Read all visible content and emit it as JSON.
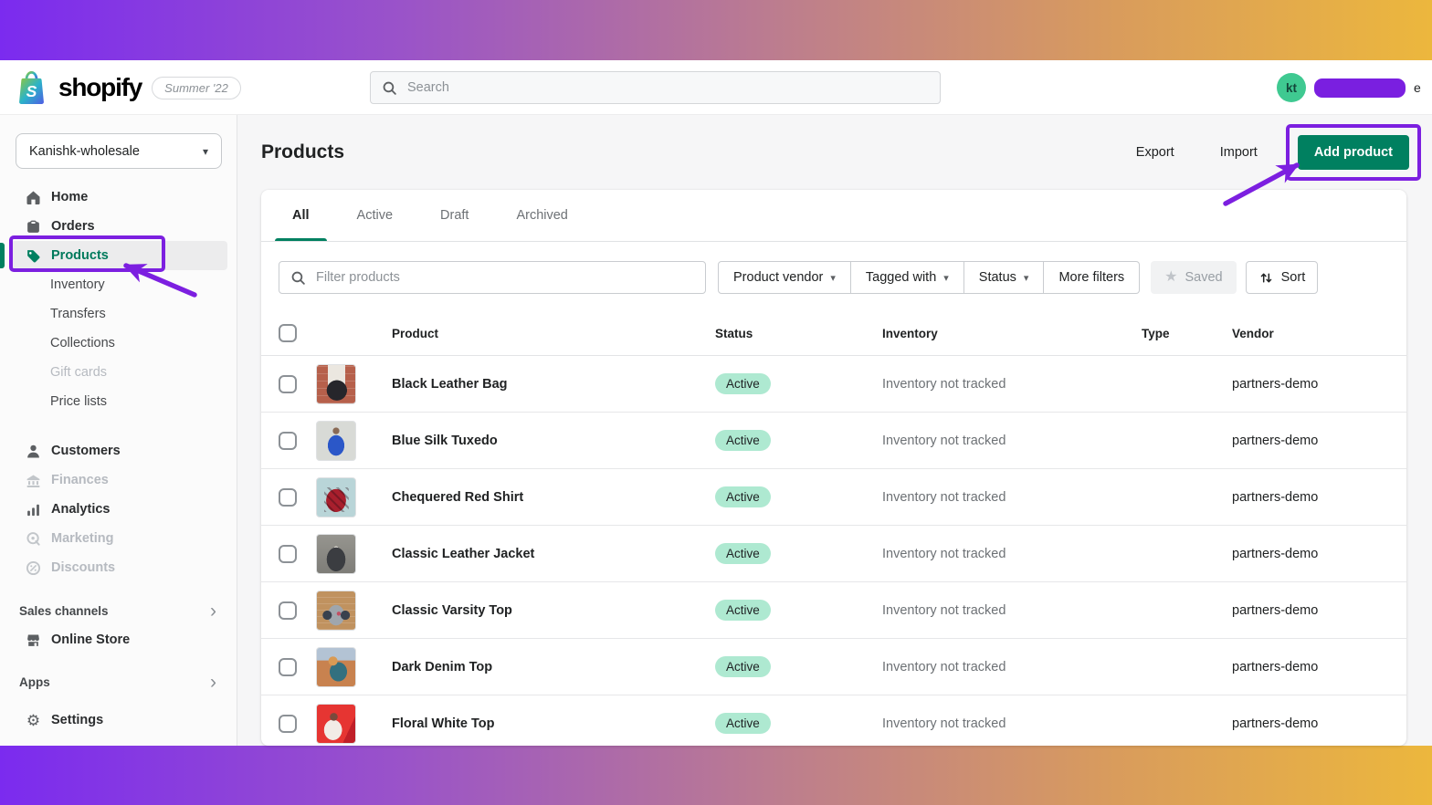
{
  "topbar": {
    "logo_text": "shopify",
    "version_badge": "Summer '22",
    "search_placeholder": "Search",
    "user_initials": "kt",
    "user_name_suffix": "e"
  },
  "sidebar": {
    "store_name": "Kanishk-wholesale",
    "nav": [
      {
        "label": "Home",
        "state": "default"
      },
      {
        "label": "Orders",
        "state": "default"
      },
      {
        "label": "Products",
        "state": "selected"
      }
    ],
    "products_sub": [
      {
        "label": "Inventory",
        "state": "default"
      },
      {
        "label": "Transfers",
        "state": "default"
      },
      {
        "label": "Collections",
        "state": "default"
      },
      {
        "label": "Gift cards",
        "state": "disabled"
      },
      {
        "label": "Price lists",
        "state": "default"
      }
    ],
    "secondary": [
      {
        "label": "Customers",
        "state": "default"
      },
      {
        "label": "Finances",
        "state": "disabled"
      },
      {
        "label": "Analytics",
        "state": "default"
      },
      {
        "label": "Marketing",
        "state": "disabled"
      },
      {
        "label": "Discounts",
        "state": "disabled"
      }
    ],
    "sales_channels_header": "Sales channels",
    "online_store_label": "Online Store",
    "apps_header": "Apps",
    "settings_label": "Settings"
  },
  "page": {
    "title": "Products",
    "export_label": "Export",
    "import_label": "Import",
    "add_product_label": "Add product"
  },
  "tabs": {
    "all": "All",
    "active": "Active",
    "draft": "Draft",
    "archived": "Archived"
  },
  "filters": {
    "search_placeholder": "Filter products",
    "product_vendor": "Product vendor",
    "tagged_with": "Tagged with",
    "status": "Status",
    "more_filters": "More filters",
    "saved": "Saved",
    "sort": "Sort"
  },
  "table": {
    "headers": {
      "product": "Product",
      "status": "Status",
      "inventory": "Inventory",
      "type": "Type",
      "vendor": "Vendor"
    },
    "rows": [
      {
        "product": "Black Leather Bag",
        "status": "Active",
        "inventory": "Inventory not tracked",
        "type": "",
        "vendor": "partners-demo"
      },
      {
        "product": "Blue Silk Tuxedo",
        "status": "Active",
        "inventory": "Inventory not tracked",
        "type": "",
        "vendor": "partners-demo"
      },
      {
        "product": "Chequered Red Shirt",
        "status": "Active",
        "inventory": "Inventory not tracked",
        "type": "",
        "vendor": "partners-demo"
      },
      {
        "product": "Classic Leather Jacket",
        "status": "Active",
        "inventory": "Inventory not tracked",
        "type": "",
        "vendor": "partners-demo"
      },
      {
        "product": "Classic Varsity Top",
        "status": "Active",
        "inventory": "Inventory not tracked",
        "type": "",
        "vendor": "partners-demo"
      },
      {
        "product": "Dark Denim Top",
        "status": "Active",
        "inventory": "Inventory not tracked",
        "type": "",
        "vendor": "partners-demo"
      },
      {
        "product": "Floral White Top",
        "status": "Active",
        "inventory": "Inventory not tracked",
        "type": "",
        "vendor": "partners-demo"
      }
    ]
  },
  "icons": {
    "logo": "shopify-bag-icon",
    "search": "magnifier-icon",
    "store_caret": "caret-down-icon",
    "home": "home-icon",
    "orders": "package-icon",
    "products": "tag-icon",
    "customers": "person-icon",
    "finances": "bank-icon",
    "analytics": "bar-chart-icon",
    "marketing": "target-icon",
    "discounts": "percent-icon",
    "online_store": "storefront-icon",
    "settings": "gear-icon",
    "saved": "star-icon",
    "sort": "sort-arrows-icon"
  },
  "colors": {
    "accent_green": "#008060",
    "annotation_purple": "#7c1fe0",
    "badge_bg": "#aee9d1",
    "avatar_bg": "#3fc991",
    "gradient_left": "#7b2bef",
    "gradient_right": "#ecb73d"
  }
}
